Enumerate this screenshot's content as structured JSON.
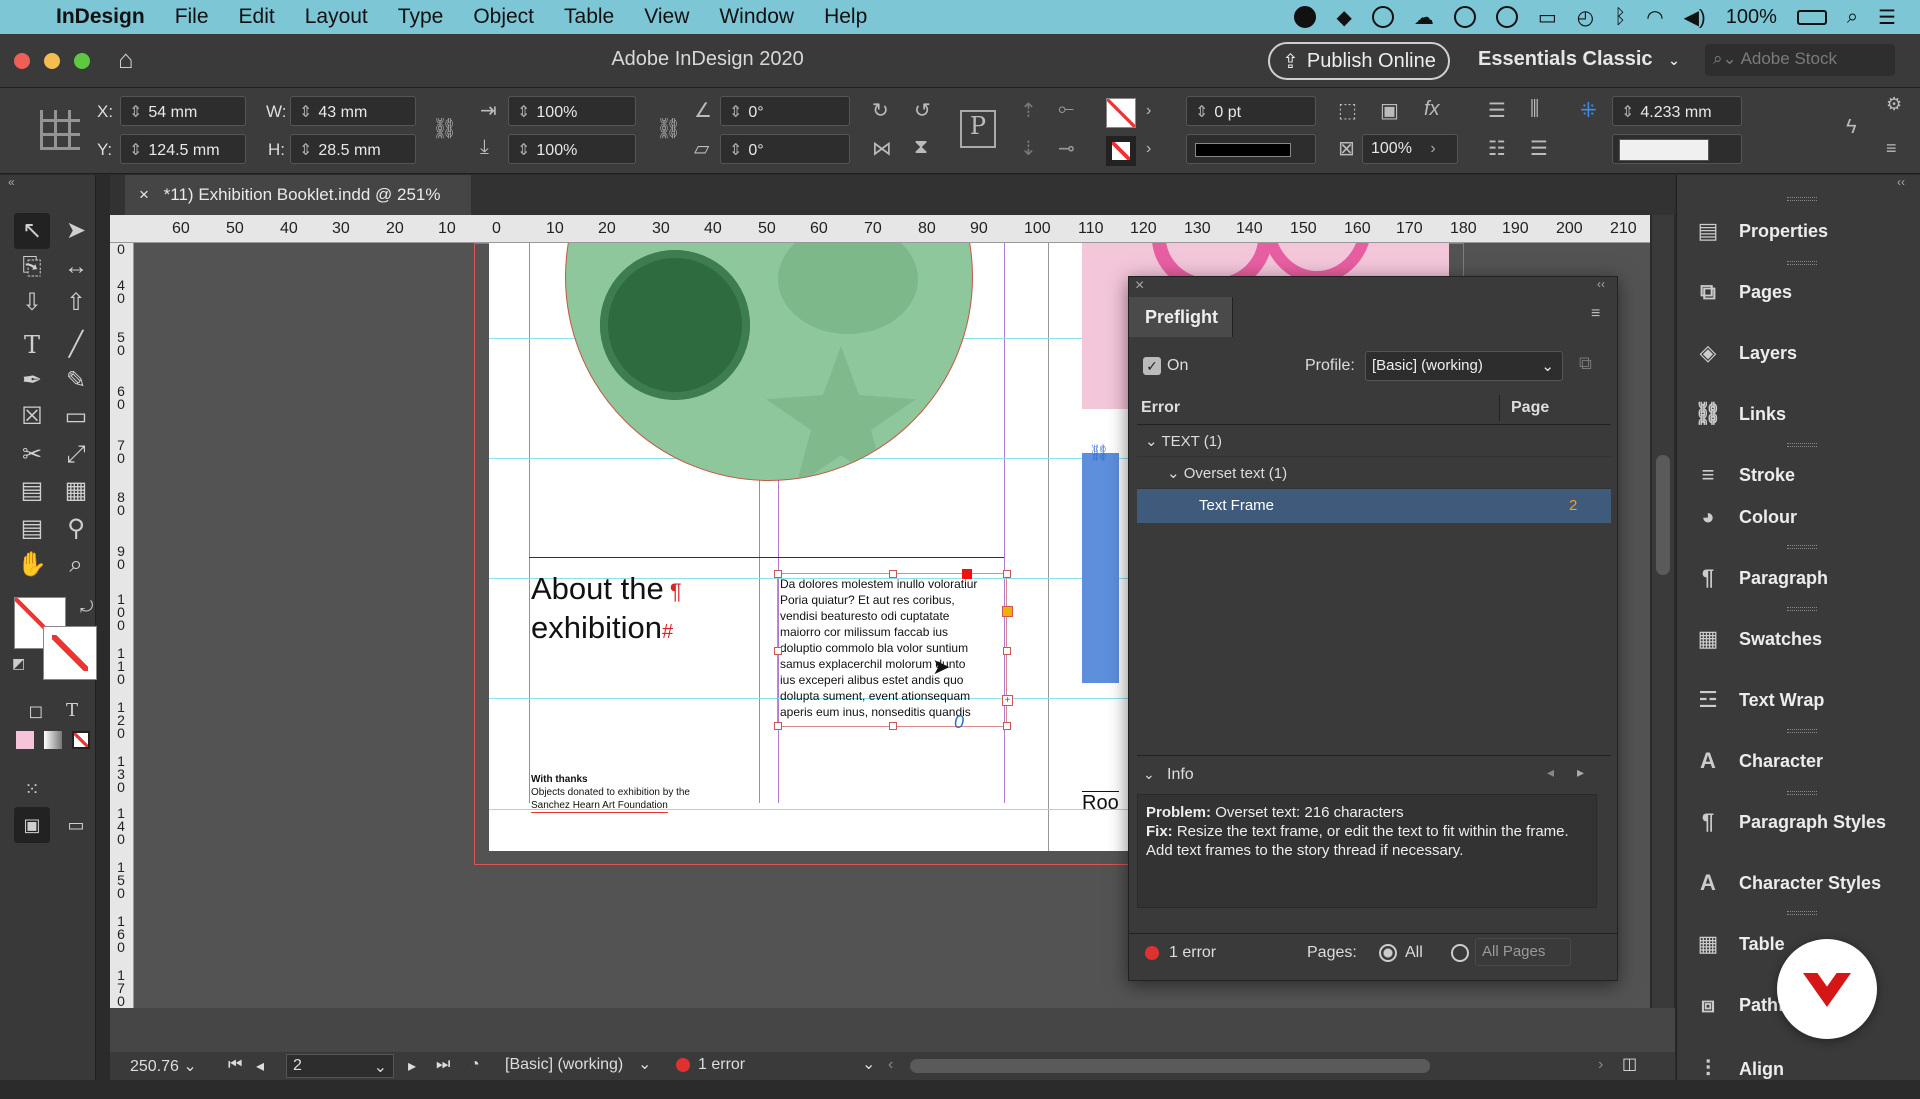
{
  "menubar": {
    "app_name": "InDesign",
    "items": [
      "File",
      "Edit",
      "Layout",
      "Type",
      "Object",
      "Table",
      "View",
      "Window",
      "Help"
    ],
    "battery": "100%"
  },
  "window": {
    "title": "Adobe InDesign 2020",
    "publish_label": "Publish Online",
    "workspace": "Essentials Classic",
    "stock_placeholder": "Adobe Stock"
  },
  "control": {
    "x_label": "X:",
    "x_value": "54 mm",
    "y_label": "Y:",
    "y_value": "124.5 mm",
    "w_label": "W:",
    "w_value": "43 mm",
    "h_label": "H:",
    "h_value": "28.5 mm",
    "scale_x": "100%",
    "scale_y": "100%",
    "rotate": "0°",
    "shear": "0°",
    "stroke_weight": "0 pt",
    "opacity": "100%",
    "gutter": "4.233 mm"
  },
  "document": {
    "tab_label": "*11) Exhibition Booklet.indd @ 251%",
    "heading_line1": "About the",
    "heading_line2": "exhibition",
    "thanks_title": "With thanks",
    "thanks_body_1": "Objects donated to exhibition by the",
    "thanks_body_2": "Sanchez Hearn Art Foundation",
    "body_lines": [
      "Da dolores molestem inullo voloratiur",
      "Poria quiatur? Et aut res coribus,",
      "vendisi beaturesto odi cuptatate",
      "maiorro cor milissum faccab ius",
      "doluptio commolo bla volor suntium",
      "samus explacerchil molorum dunto",
      "ius exceperi alibus estet andis quo",
      "dolupta sument, event ationsequam",
      "aperis eum inus, nonseditis quandis"
    ],
    "right_page_text": "Roo"
  },
  "rulers": {
    "h_ticks": [
      "60",
      "50",
      "40",
      "30",
      "20",
      "10",
      "0",
      "10",
      "20",
      "30",
      "40",
      "50",
      "60",
      "70",
      "80",
      "90",
      "100",
      "110",
      "120",
      "130",
      "140",
      "150",
      "160",
      "170",
      "180",
      "190",
      "200",
      "210"
    ],
    "v_ticks": [
      "0",
      "4\n0",
      "5\n0",
      "6\n0",
      "7\n0",
      "8\n0",
      "9\n0",
      "1\n0\n0",
      "1\n1\n0",
      "1\n2\n0",
      "1\n3\n0",
      "1\n4\n0",
      "1\n5\n0",
      "1\n6\n0",
      "1\n7\n0"
    ]
  },
  "preflight": {
    "title": "Preflight",
    "on_label": "On",
    "profile_label": "Profile:",
    "profile_value": "[Basic] (working)",
    "col_error": "Error",
    "col_page": "Page",
    "tree": [
      {
        "label": "TEXT (1)",
        "page": ""
      },
      {
        "label": "Overset text (1)",
        "page": ""
      },
      {
        "label": "Text Frame",
        "page": "2"
      }
    ],
    "info_label": "Info",
    "problem_label": "Problem:",
    "problem_text": "Overset text: 216 characters",
    "fix_label": "Fix:",
    "fix_text": "Resize the text frame, or edit the text to fit within the frame. Add text frames to the story thread if necessary.",
    "errors": "1 error",
    "pages_label": "Pages:",
    "all_label": "All",
    "all_pages_placeholder": "All Pages"
  },
  "panels": [
    "Properties",
    "Pages",
    "Layers",
    "Links",
    "Stroke",
    "Colour",
    "Paragraph",
    "Swatches",
    "Text Wrap",
    "Character",
    "Paragraph Styles",
    "Character Styles",
    "Table",
    "Pathfinder",
    "Align"
  ],
  "status": {
    "zoom": "250.76",
    "page": "2",
    "profile": "[Basic] (working)",
    "errors": "1 error"
  },
  "colors": {
    "menubar_bg": "#7cc6d6",
    "selection_blue": "#3f5a7a",
    "error_red": "#e03131",
    "circle_green": "#8fc69a",
    "pink": "#f4c6da"
  }
}
